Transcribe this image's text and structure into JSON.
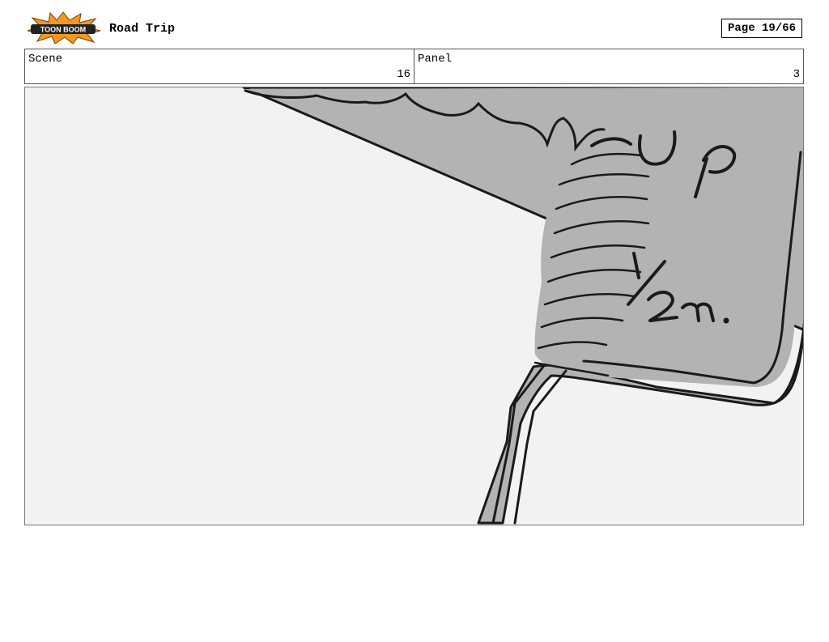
{
  "header": {
    "logo_text": "TOON BOOM",
    "project_title": "Road Trip",
    "page_label": "Page 19/66"
  },
  "info": {
    "scene_label": "Scene",
    "scene_value": "16",
    "panel_label": "Panel",
    "panel_value": "3"
  },
  "colors": {
    "panel_background": "#f2f2f2",
    "cup_fill": "#b3b3b3",
    "ink": "#1a1a1a",
    "logo_orange": "#f39a1e"
  }
}
